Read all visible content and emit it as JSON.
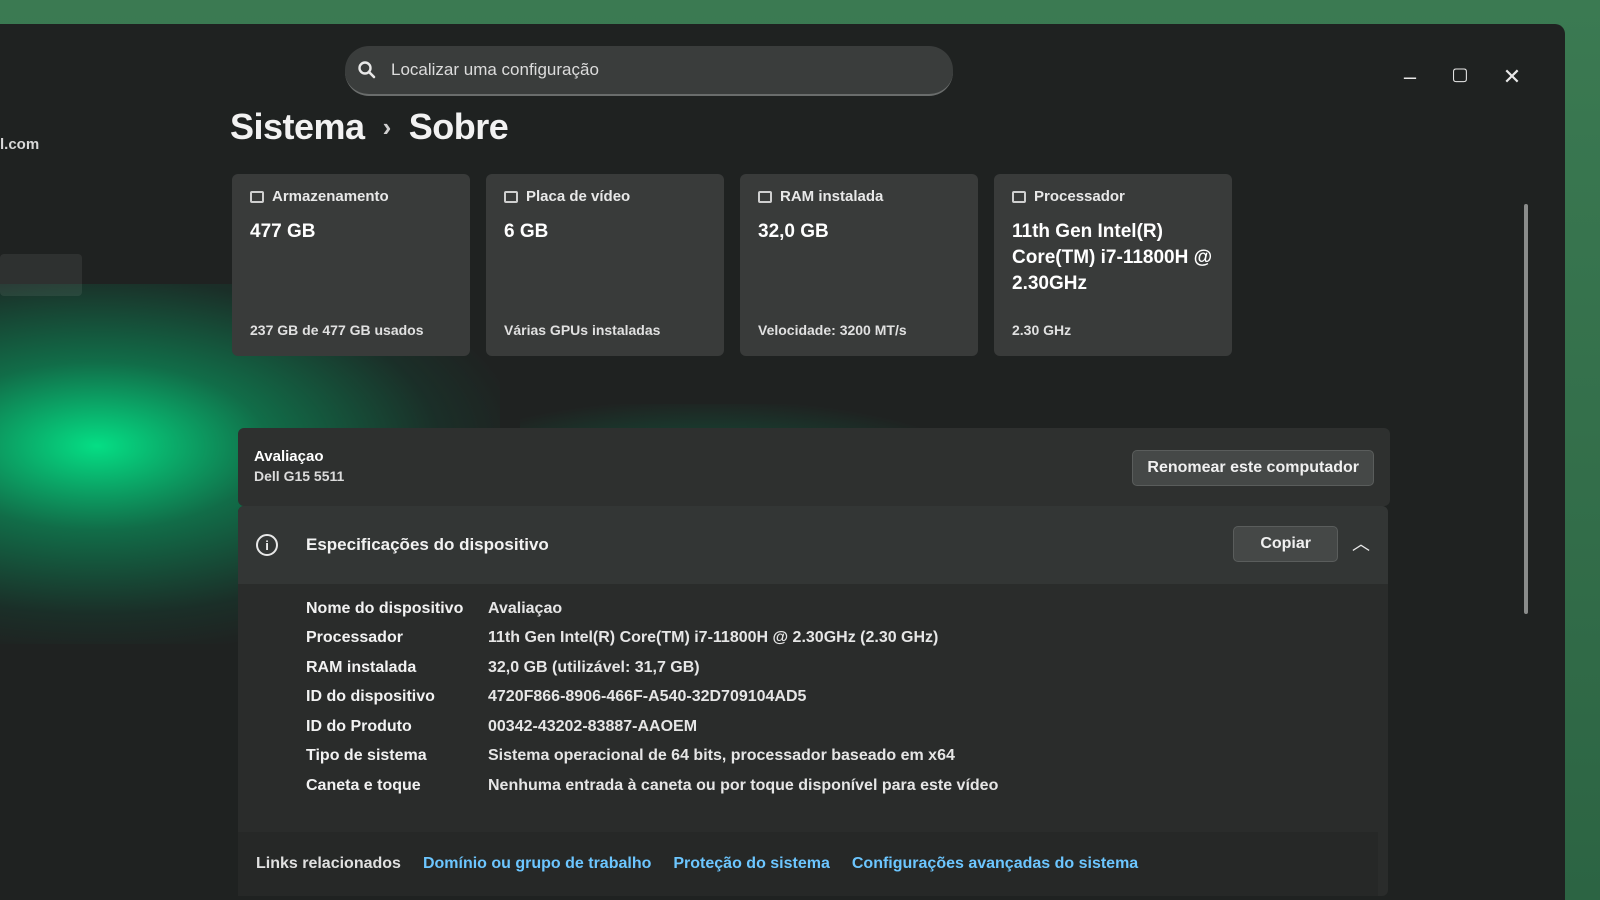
{
  "sidebar": {
    "email_fragment": "l.com"
  },
  "search": {
    "placeholder": "Localizar uma configuração"
  },
  "window": {
    "minimize": "–",
    "maximize": "▢",
    "close": "✕"
  },
  "breadcrumb": {
    "parent": "Sistema",
    "separator": "›",
    "current": "Sobre"
  },
  "cards": [
    {
      "label": "Armazenamento",
      "value": "477 GB",
      "sub": "237 GB de 477 GB usados"
    },
    {
      "label": "Placa de vídeo",
      "value": "6 GB",
      "sub": "Várias GPUs instaladas"
    },
    {
      "label": "RAM instalada",
      "value": "32,0 GB",
      "sub": "Velocidade: 3200 MT/s"
    },
    {
      "label": "Processador",
      "value": "11th Gen Intel(R) Core(TM) i7-11800H @ 2.30GHz",
      "sub": "2.30 GHz"
    }
  ],
  "device": {
    "name": "Avaliaçao",
    "model": "Dell G15 5511",
    "rename_label": "Renomear este computador"
  },
  "specs": {
    "title": "Especificações do dispositivo",
    "copy_label": "Copiar",
    "rows": [
      {
        "k": "Nome do dispositivo",
        "v": "Avaliaçao"
      },
      {
        "k": "Processador",
        "v": "11th Gen Intel(R) Core(TM) i7-11800H @ 2.30GHz (2.30 GHz)"
      },
      {
        "k": "RAM instalada",
        "v": "32,0 GB (utilizável: 31,7 GB)"
      },
      {
        "k": "ID do dispositivo",
        "v": "4720F866-8906-466F-A540-32D709104AD5"
      },
      {
        "k": "ID do Produto",
        "v": "00342-43202-83887-AAOEM"
      },
      {
        "k": "Tipo de sistema",
        "v": "Sistema operacional de 64 bits, processador baseado em x64"
      },
      {
        "k": "Caneta e toque",
        "v": "Nenhuma entrada à caneta ou por toque disponível para este vídeo"
      }
    ]
  },
  "links": {
    "label": "Links relacionados",
    "items": [
      "Domínio ou grupo de trabalho",
      "Proteção do sistema",
      "Configurações avançadas do sistema"
    ]
  },
  "colors": {
    "link": "#6cc6ff",
    "glare": "#00ff96"
  }
}
